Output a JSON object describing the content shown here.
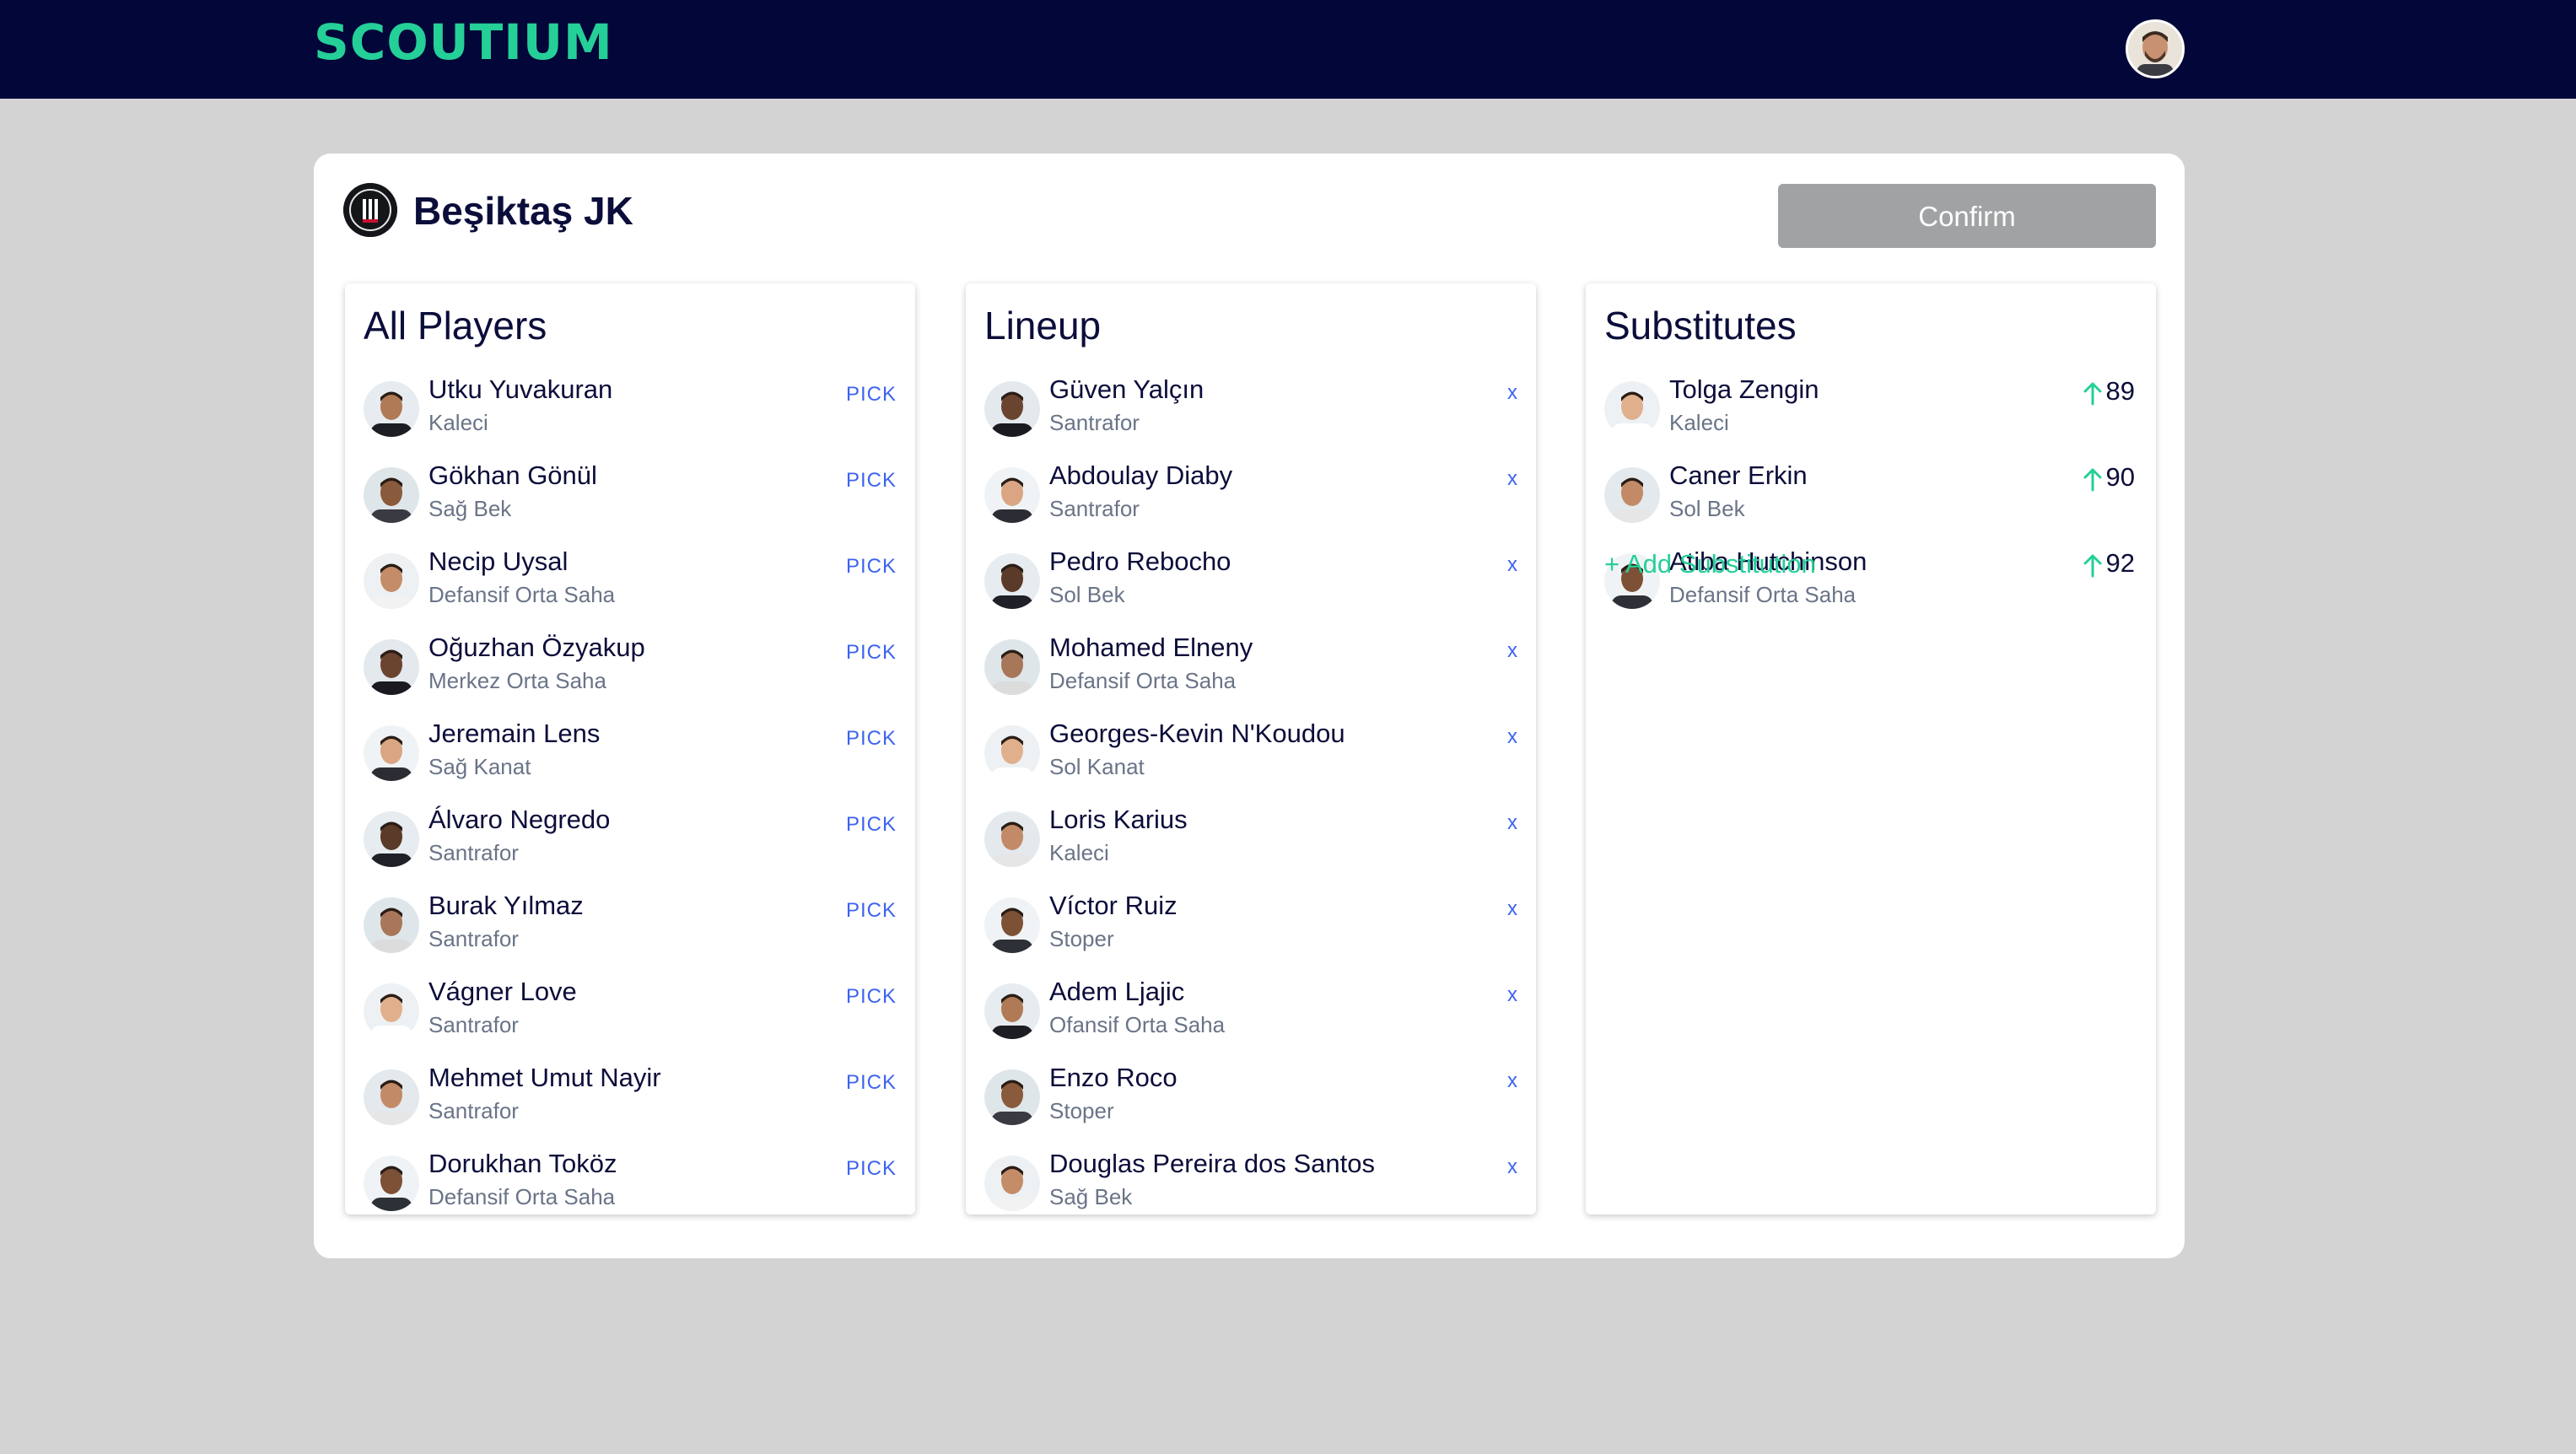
{
  "app": {
    "logo": "SCOUTIUM"
  },
  "team": {
    "name": "Beşiktaş JK",
    "confirm_label": "Confirm"
  },
  "panels": {
    "all_players": {
      "title": "All Players",
      "action_label": "PICK",
      "items": [
        {
          "name": "Utku Yuvakuran",
          "position": "Kaleci"
        },
        {
          "name": "Gökhan Gönül",
          "position": "Sağ Bek"
        },
        {
          "name": "Necip Uysal",
          "position": "Defansif Orta Saha"
        },
        {
          "name": "Oğuzhan Özyakup",
          "position": "Merkez Orta Saha"
        },
        {
          "name": "Jeremain Lens",
          "position": "Sağ Kanat"
        },
        {
          "name": "Álvaro Negredo",
          "position": "Santrafor"
        },
        {
          "name": "Burak Yılmaz",
          "position": "Santrafor"
        },
        {
          "name": "Vágner Love",
          "position": "Santrafor"
        },
        {
          "name": "Mehmet Umut Nayir",
          "position": "Santrafor"
        },
        {
          "name": "Dorukhan Toköz",
          "position": "Defansif Orta Saha"
        }
      ]
    },
    "lineup": {
      "title": "Lineup",
      "action_label": "x",
      "items": [
        {
          "name": "Güven Yalçın",
          "position": "Santrafor"
        },
        {
          "name": "Abdoulay Diaby",
          "position": "Santrafor"
        },
        {
          "name": "Pedro Rebocho",
          "position": "Sol Bek"
        },
        {
          "name": "Mohamed Elneny",
          "position": "Defansif Orta Saha"
        },
        {
          "name": "Georges-Kevin N'Koudou",
          "position": "Sol Kanat"
        },
        {
          "name": "Loris Karius",
          "position": "Kaleci"
        },
        {
          "name": "Víctor Ruiz",
          "position": "Stoper"
        },
        {
          "name": "Adem Ljajic",
          "position": "Ofansif Orta Saha"
        },
        {
          "name": "Enzo Roco",
          "position": "Stoper"
        },
        {
          "name": "Douglas Pereira dos Santos",
          "position": "Sağ Bek"
        }
      ]
    },
    "substitutes": {
      "title": "Substitutes",
      "add_label": "+ Add Substitution",
      "items": [
        {
          "name": "Tolga Zengin",
          "position": "Kaleci",
          "minute": "89"
        },
        {
          "name": "Caner Erkin",
          "position": "Sol Bek",
          "minute": "90"
        },
        {
          "name": "Atiba Hutchinson",
          "position": "Defansif Orta Saha",
          "minute": "92"
        }
      ]
    }
  },
  "colors": {
    "topbar": "#020638",
    "brand": "#25cf98",
    "action": "#3d63f0",
    "confirm_disabled": "#a0a2a4",
    "background": "#d3d3d3"
  }
}
